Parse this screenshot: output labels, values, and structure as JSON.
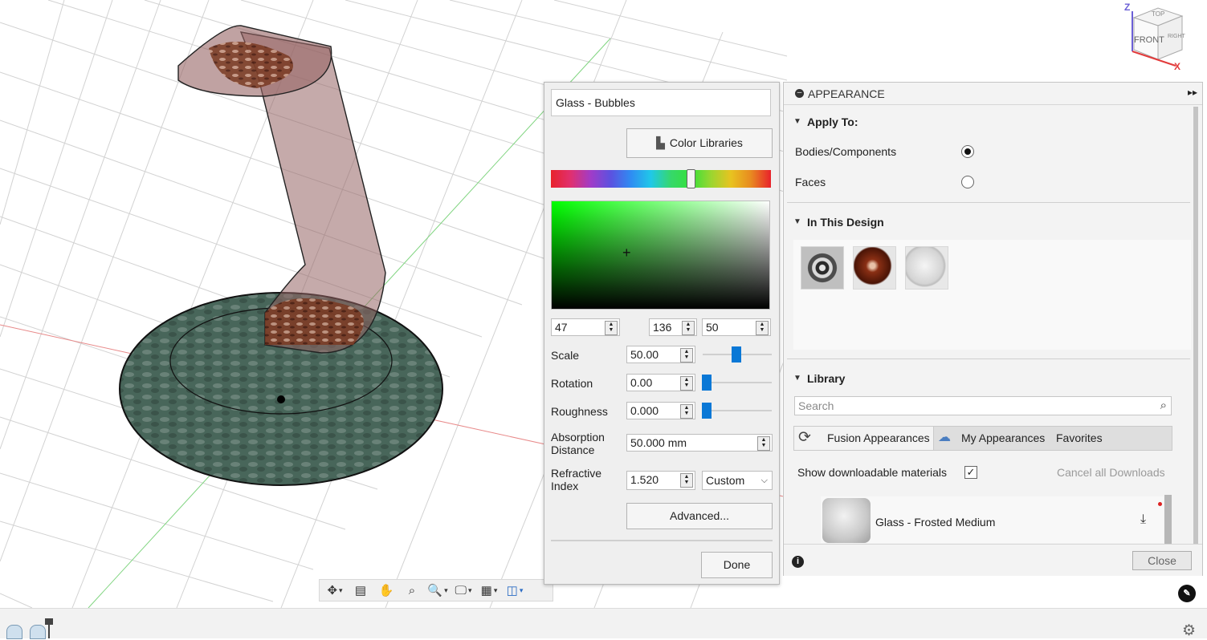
{
  "viewcube": {
    "faces": [
      "TOP",
      "FRONT",
      "RIGHT"
    ],
    "axes": [
      "Z",
      "X"
    ]
  },
  "nav_toolbar": {
    "items": [
      "orbit-icon",
      "look-at-icon",
      "pan-icon",
      "zoom-window-icon",
      "fit-icon",
      "display-settings-icon",
      "grid-icon",
      "viewports-icon"
    ]
  },
  "editor": {
    "appearance_name": "Glass - Bubbles",
    "color_libraries_label": "Color Libraries",
    "rgb": [
      "47",
      "136",
      "50"
    ],
    "hue_fraction": 0.645,
    "fields": {
      "scale_label": "Scale",
      "scale_value": "50.00",
      "scale_slider": 0.5,
      "rotation_label": "Rotation",
      "rotation_value": "0.00",
      "rotation_slider": 0.0,
      "roughness_label": "Roughness",
      "roughness_value": "0.000",
      "roughness_slider": 0.0,
      "absorption_label_1": "Absorption",
      "absorption_label_2": "Distance",
      "absorption_value": "50.000 mm",
      "refractive_label_1": "Refractive",
      "refractive_label_2": "Index",
      "refractive_value": "1.520",
      "refractive_preset": "Custom"
    },
    "advanced_label": "Advanced...",
    "done_label": "Done"
  },
  "appearance": {
    "title": "APPEARANCE",
    "apply_to": {
      "title": "Apply To:",
      "options": [
        "Bodies/Components",
        "Faces"
      ],
      "selected": "Bodies/Components"
    },
    "in_design": {
      "title": "In This Design",
      "swatches": [
        "chrome-swatch",
        "brown-glass-swatch",
        "frosted-glass-swatch"
      ]
    },
    "library": {
      "title": "Library",
      "search_placeholder": "Search",
      "tabs": [
        "Fusion Appearances",
        "My Appearances",
        "Favorites"
      ],
      "show_downloadable_label": "Show downloadable materials",
      "show_downloadable_checked": true,
      "cancel_downloads_label": "Cancel all Downloads",
      "materials": [
        "Glass - Frosted Medium"
      ]
    },
    "close_label": "Close",
    "accent_color": "#0a78d6"
  }
}
